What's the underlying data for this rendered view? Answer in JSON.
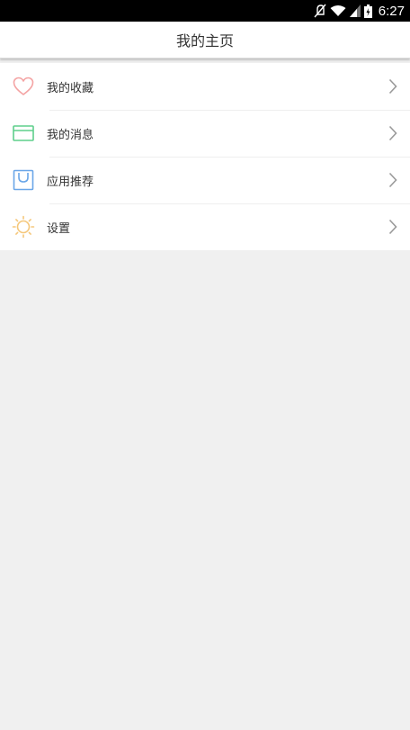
{
  "status_bar": {
    "time": "6:27",
    "icons": [
      "mute-icon",
      "wifi-icon",
      "signal-icon",
      "battery-icon"
    ]
  },
  "header": {
    "title": "我的主页"
  },
  "menu": {
    "items": [
      {
        "label": "我的收藏",
        "icon": "heart-icon",
        "icon_color": "#f4a3a3"
      },
      {
        "label": "我的消息",
        "icon": "envelope-icon",
        "icon_color": "#5fcf8c"
      },
      {
        "label": "应用推荐",
        "icon": "shopping-bag-icon",
        "icon_color": "#6aa6e8"
      },
      {
        "label": "设置",
        "icon": "sun-icon",
        "icon_color": "#f5c77a"
      }
    ],
    "chevron_icon": "chevron-right-icon",
    "chevron_color": "#9a9a9a"
  },
  "colors": {
    "page_background": "#f0f0f0",
    "card_background": "#ffffff",
    "status_bar": "#000000"
  }
}
